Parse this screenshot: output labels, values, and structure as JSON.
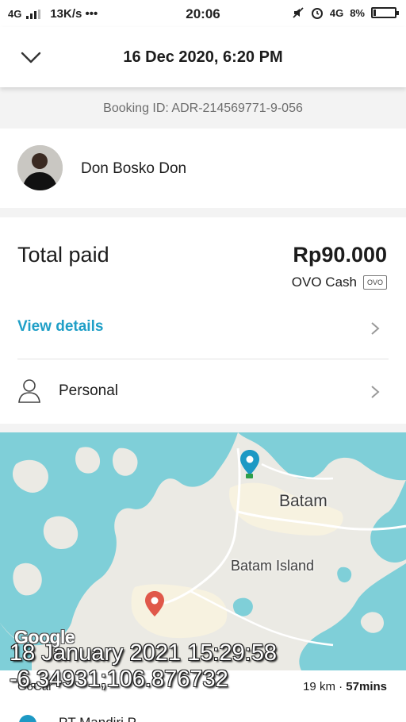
{
  "status_bar": {
    "network": "4G",
    "speed": "13K/s •••",
    "time": "20:06",
    "network_right": "4G",
    "battery": "8%"
  },
  "header": {
    "title": "16 Dec 2020, 6:20 PM"
  },
  "booking": {
    "id_text": "Booking ID: ADR-214569771-9-056"
  },
  "driver": {
    "name": "Don Bosko Don"
  },
  "payment": {
    "total_label": "Total paid",
    "total_amount": "Rp90.000",
    "method": "OVO Cash",
    "method_badge": "OVO",
    "view_details": "View details",
    "profile": "Personal"
  },
  "map": {
    "label_city": "Batam",
    "label_island": "Batam Island",
    "google_logo": "Google",
    "stamp_date": "18 January 2021 15:29:58",
    "stamp_coords": "-6.34931;106.876732",
    "car_type": "GoCar",
    "distance": "19 km",
    "duration": "57mins",
    "separator": " · ",
    "pickup_partial": "PT Mandiri P..."
  },
  "colors": {
    "accent": "#1f9fc7",
    "sea": "#7fcfd8",
    "land": "#ebeae4",
    "pickup": "#1d99c4",
    "dropoff": "#e0584a"
  }
}
